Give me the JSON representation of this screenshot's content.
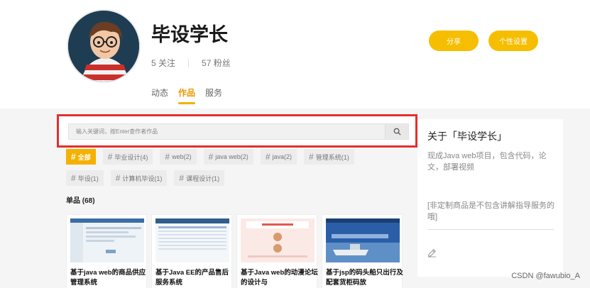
{
  "profile": {
    "name": "毕设学长",
    "follow_label": "5 关注",
    "fans_label": "57 粉丝"
  },
  "header_buttons": {
    "share": "分享",
    "settings": "个性设置"
  },
  "tabs": [
    {
      "label": "动态",
      "active": false
    },
    {
      "label": "作品",
      "active": true
    },
    {
      "label": "服务",
      "active": false
    }
  ],
  "search": {
    "placeholder": "输入关键词，按Enter查作者作品",
    "icon": "search-icon"
  },
  "tags": [
    {
      "label": "全部",
      "active": true
    },
    {
      "label": "毕业设计(4)"
    },
    {
      "label": "web(2)"
    },
    {
      "label": "java web(2)"
    },
    {
      "label": "java(2)"
    },
    {
      "label": "管理系统(1)"
    },
    {
      "label": "毕设(1)"
    },
    {
      "label": "计算机毕设(1)"
    },
    {
      "label": "课程设计(1)"
    }
  ],
  "section": {
    "title": "单品 (68)"
  },
  "cards": [
    {
      "title": "基于java web的商品供应管理系统"
    },
    {
      "title": "基于Java EE的产品售后服务系统"
    },
    {
      "title": "基于Java web的动漫论坛的设计与"
    },
    {
      "title": "基于jsp的码头船只出行及配套货柜码放"
    }
  ],
  "side": {
    "title": "关于「毕设学长」",
    "desc": "现成Java web项目，包含代码，论文，部署视频",
    "note": "[非定制商品是不包含讲解指导服务的哦]",
    "edit_icon": "edit-icon"
  },
  "watermark": "CSDN @fawubio_A",
  "colors": {
    "accent": "#f5b100",
    "highlight_border": "#e32f2f"
  }
}
